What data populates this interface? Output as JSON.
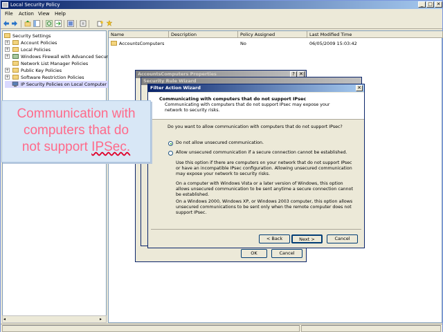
{
  "window": {
    "title": "Local Security Policy",
    "controls": {
      "minimize": "_",
      "maximize": "□",
      "close": "✕"
    }
  },
  "menu": [
    "File",
    "Action",
    "View",
    "Help"
  ],
  "toolbar_icons": [
    "back-arrow-icon",
    "forward-arrow-icon",
    "up-folder-icon",
    "show-hide-tree-icon",
    "refresh-icon",
    "export-list-icon",
    "help-icon",
    "properties-icon",
    "new-policy-icon"
  ],
  "tree": {
    "root": "Security Settings",
    "items": [
      {
        "label": "Account Policies",
        "expander": "+"
      },
      {
        "label": "Local Policies",
        "expander": "+"
      },
      {
        "label": "Windows Firewall with Advanced Security",
        "expander": "+"
      },
      {
        "label": "Network List Manager Policies",
        "expander": ""
      },
      {
        "label": "Public Key Policies",
        "expander": "+"
      },
      {
        "label": "Software Restriction Policies",
        "expander": "+"
      },
      {
        "label": "IP Security Policies on Local Computer",
        "expander": ""
      }
    ]
  },
  "list": {
    "headers": [
      "Name",
      "Description",
      "Policy Assigned",
      "Last Modified Time"
    ],
    "rows": [
      {
        "name": "AccountsComputers",
        "description": "",
        "assigned": "No",
        "modified": "06/05/2009 15:03:42"
      }
    ]
  },
  "properties_dialog": {
    "title": "AccountsComputers Properties",
    "help": "?",
    "close": "✕",
    "ok": "OK",
    "cancel": "Cancel"
  },
  "rule_wizard": {
    "title": "Security Rule Wizard"
  },
  "filter_wizard": {
    "title": "Filter Action Wizard",
    "close": "✕",
    "header_title": "Communicating with computers that do not support IPsec",
    "header_sub": "Communicating with computers that do not support IPsec may expose your network to security risks.",
    "question": "Do you want to allow communication with computers that do not support IPsec?",
    "option1": "Do not allow unsecured communication.",
    "option2": "Allow unsecured communication if a secure connection cannot be established.",
    "para1": "Use this option if there are computers on your network that do not support IPsec or have an incompatible IPsec configuration. Allowing unsecured communication may expose your network to security risks.",
    "para2": "On a computer with Windows Vista or a later version of Windows, this option allows unsecured communication to be sent anytime a secure connection cannot be established.",
    "para3": "On a Windows 2000, Windows XP, or Windows 2003 computer, this option allows unsecured communications to be sent only when the remote computer does not support IPsec.",
    "back": "< Back",
    "next": "Next >",
    "cancel": "Cancel"
  },
  "callout": {
    "line1": "Communication with",
    "line2": "computers that do",
    "line3": "not support ",
    "line3_emph": "IPSec."
  }
}
